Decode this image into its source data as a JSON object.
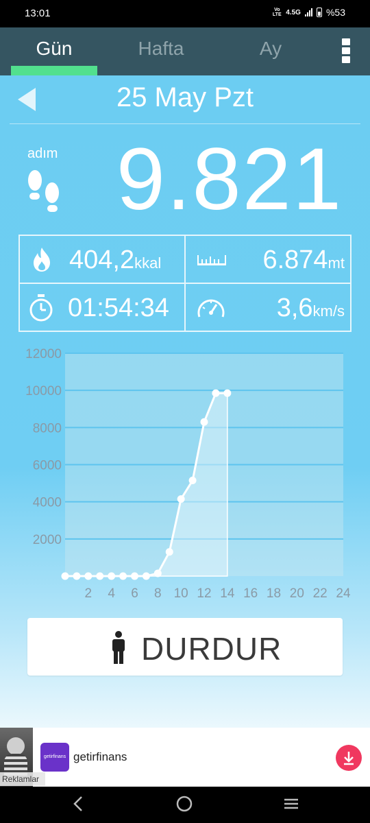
{
  "status_bar": {
    "time": "13:01",
    "volte": "Vo LTE",
    "network": "4.5G",
    "battery": "%53"
  },
  "tabs": [
    {
      "label": "Gün"
    },
    {
      "label": "Hafta"
    },
    {
      "label": "Ay"
    }
  ],
  "active_tab": "Gün",
  "header": {
    "date": "25 May Pzt"
  },
  "steps": {
    "label": "adım",
    "value": "9.821"
  },
  "stats": {
    "calories": {
      "value": "404,2",
      "unit": "kkal"
    },
    "distance": {
      "value": "6.874",
      "unit": "mt"
    },
    "duration": {
      "value": "01:54:34"
    },
    "speed": {
      "value": "3,6",
      "unit": "km/s"
    }
  },
  "chart_data": {
    "type": "line",
    "x": [
      0,
      1,
      2,
      3,
      4,
      5,
      6,
      7,
      8,
      9,
      10,
      11,
      12,
      13,
      14
    ],
    "values": [
      0,
      0,
      0,
      0,
      0,
      0,
      0,
      0,
      150,
      1300,
      4150,
      5150,
      8300,
      9850,
      9850
    ],
    "xlim": [
      0,
      24
    ],
    "ylim": [
      0,
      12000
    ],
    "x_tick_labels": [
      "2",
      "4",
      "6",
      "8",
      "10",
      "12",
      "14",
      "16",
      "18",
      "20",
      "22",
      "24"
    ],
    "y_tick_labels": [
      "2000",
      "4000",
      "6000",
      "8000",
      "10000",
      "12000"
    ],
    "grid": true
  },
  "stop_button": {
    "label": "DURDUR"
  },
  "ad": {
    "label": "Reklamlar",
    "logo_text": "getirfinans",
    "name": "getirfinans"
  },
  "colors": {
    "header": "#355561",
    "accent": "#52e08e",
    "background": "#6ccdf2",
    "ad_logo": "#6a32c9",
    "download": "#f0385f"
  },
  "icons": [
    "footprints-icon",
    "fire-icon",
    "ruler-icon",
    "stopwatch-icon",
    "speedometer-icon",
    "person-icon",
    "download-icon",
    "back-icon",
    "home-icon",
    "recents-icon"
  ]
}
